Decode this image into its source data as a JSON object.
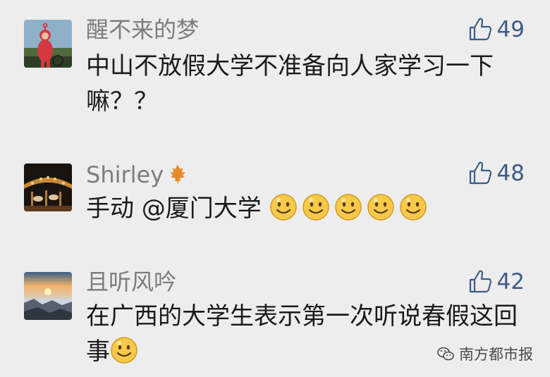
{
  "comments": [
    {
      "nickname": "醒不来的梦",
      "likes": "49",
      "content": "中山不放假大学不准备向人家学习一下嘛？？",
      "avatar_icon": "teletubby-avatar"
    },
    {
      "nickname": "Shirley",
      "likes": "48",
      "content_text": "手动 @厦门大学 ",
      "smiley_count": 5,
      "avatar_icon": "carousel-avatar"
    },
    {
      "nickname": "且听风吟",
      "likes": "42",
      "content_text": "在广西的大学生表示第一次听说春假这回事",
      "smiley_count": 1,
      "avatar_icon": "sunrise-avatar"
    }
  ],
  "watermark": {
    "text": "南方都市报",
    "icon": "wechat-icon"
  },
  "colors": {
    "background": "#ededed",
    "like": "#3f5b86",
    "nickname": "#7d7d7d",
    "content": "#1b1b1b"
  }
}
